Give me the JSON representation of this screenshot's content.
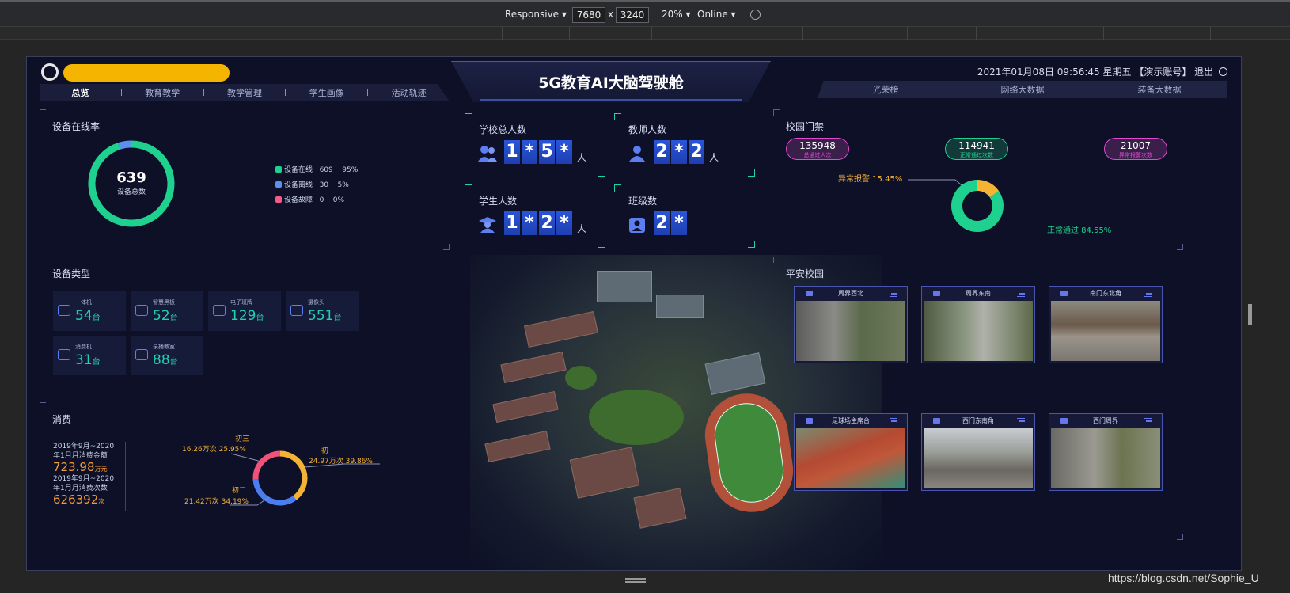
{
  "devtools": {
    "device_mode": "Responsive",
    "width": "7680",
    "times": "x",
    "height": "3240",
    "zoom": "20%",
    "network": "Online"
  },
  "header": {
    "title": "5G教育AI大脑驾驶舱",
    "datetime": "2021年01月08日 09:56:45 星期五",
    "account": "【演示账号】",
    "logout": "退出"
  },
  "nav_left": [
    "总览",
    "教育教学",
    "教学管理",
    "学生画像",
    "活动轨迹"
  ],
  "nav_right": [
    "光荣榜",
    "网络大数据",
    "装备大数据"
  ],
  "device_online": {
    "title": "设备在线率",
    "total": "639",
    "total_label": "设备总数",
    "legend": [
      {
        "label": "设备在线",
        "count": "609",
        "pct": "95%",
        "color": "#1fd18f",
        "value": 95
      },
      {
        "label": "设备离线",
        "count": "30",
        "pct": "5%",
        "color": "#5b8ff0",
        "value": 5
      },
      {
        "label": "设备故障",
        "count": "0",
        "pct": "0%",
        "color": "#f05b8a",
        "value": 0
      }
    ]
  },
  "device_types": {
    "title": "设备类型",
    "items": [
      {
        "name": "一体机",
        "value": "54",
        "unit": "台"
      },
      {
        "name": "智慧黑板",
        "value": "52",
        "unit": "台"
      },
      {
        "name": "电子班牌",
        "value": "129",
        "unit": "台"
      },
      {
        "name": "摄像头",
        "value": "551",
        "unit": "台"
      },
      {
        "name": "消费机",
        "value": "31",
        "unit": "台"
      },
      {
        "name": "录播教室",
        "value": "88",
        "unit": "台"
      }
    ]
  },
  "consumption": {
    "title": "消费",
    "amount_label": "2019年9月~2020年1月月消费金额",
    "amount": "723.98",
    "amount_unit": "万元",
    "count_label": "2019年9月~2020年1月月消费次数",
    "count": "626392",
    "count_unit": "次",
    "slices": [
      {
        "name": "初一",
        "text": "24.97万次 39.86%",
        "value": 39.86,
        "color": "#f5b335"
      },
      {
        "name": "初二",
        "text": "21.42万次 34.19%",
        "value": 34.19,
        "color": "#4a7df0"
      },
      {
        "name": "初三",
        "text": "16.26万次 25.95%",
        "value": 25.95,
        "color": "#f0527a"
      }
    ]
  },
  "stats": [
    {
      "label": "学校总人数",
      "digits": [
        "1",
        "*",
        "5",
        "*"
      ],
      "unit": "人"
    },
    {
      "label": "教师人数",
      "digits": [
        "2",
        "*",
        "2"
      ],
      "unit": "人"
    },
    {
      "label": "学生人数",
      "digits": [
        "1",
        "*",
        "2",
        "*"
      ],
      "unit": "人"
    },
    {
      "label": "班级数",
      "digits": [
        "2",
        "*"
      ],
      "unit": ""
    }
  ],
  "gate": {
    "title": "校园门禁",
    "pills": [
      {
        "value": "135948",
        "label": "总通过人次",
        "color": "#e04ad0",
        "bg": "#3a1f4a"
      },
      {
        "value": "114941",
        "label": "正常通过次数",
        "color": "#1fd18f",
        "bg": "#123a3a"
      },
      {
        "value": "21007",
        "label": "异常报警次数",
        "color": "#e04ad0",
        "bg": "#3a1f4a"
      }
    ],
    "abnormal_text": "异常报警  15.45%",
    "normal_text": "正常通过  84.55%",
    "abnormal_pct": 15.45,
    "normal_pct": 84.55,
    "abnormal_color": "#f5b335",
    "normal_color": "#1fd18f"
  },
  "safety": {
    "title": "平安校园",
    "cams": [
      "周界西北",
      "周界东南",
      "南门东北角",
      "足球场主席台",
      "西门东南角",
      "西门周界"
    ]
  },
  "watermark": "https://blog.csdn.net/Sophie_U"
}
